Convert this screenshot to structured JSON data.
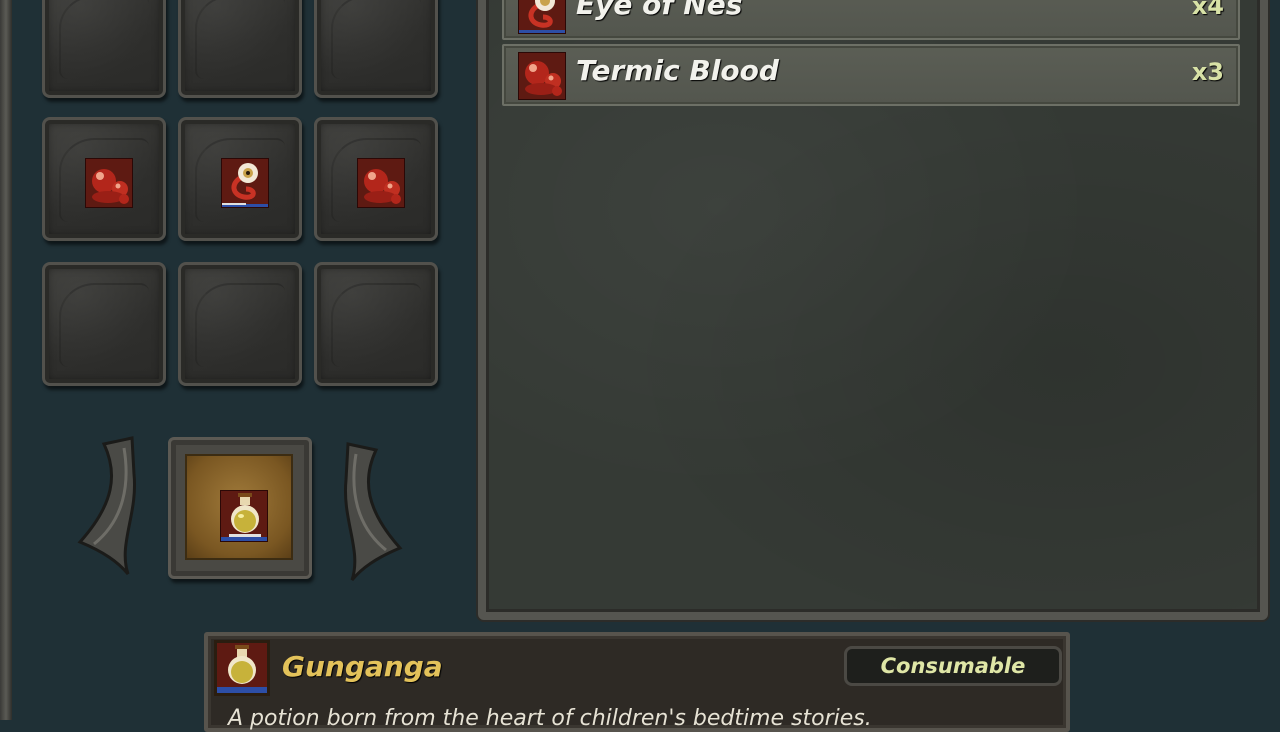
{
  "inventory": {
    "rows": [
      {
        "slots": [
          {
            "item": null
          },
          {
            "item": null
          },
          {
            "item": null
          }
        ]
      },
      {
        "slots": [
          {
            "item": "termic-blood-icon"
          },
          {
            "item": "eye-of-nes-icon"
          },
          {
            "item": "termic-blood-icon"
          }
        ]
      },
      {
        "slots": [
          {
            "item": null
          },
          {
            "item": null
          },
          {
            "item": null
          }
        ]
      }
    ]
  },
  "equipped": {
    "item_icon": "gunganga-potion-icon"
  },
  "item_list": [
    {
      "name": "Eye of Nes",
      "qty": "x4",
      "icon": "eye-of-nes-icon"
    },
    {
      "name": "Termic Blood",
      "qty": "x3",
      "icon": "termic-blood-icon"
    }
  ],
  "details": {
    "name": "Gunganga",
    "type": "Consumable",
    "description": "A potion born from the heart of children's bedtime stories.",
    "icon": "gunganga-potion-icon"
  },
  "colors": {
    "background": "#1f3036",
    "title_gold": "#e3c25a",
    "qty_green": "#d8e2a6",
    "icon_red": "#5e1a12"
  }
}
